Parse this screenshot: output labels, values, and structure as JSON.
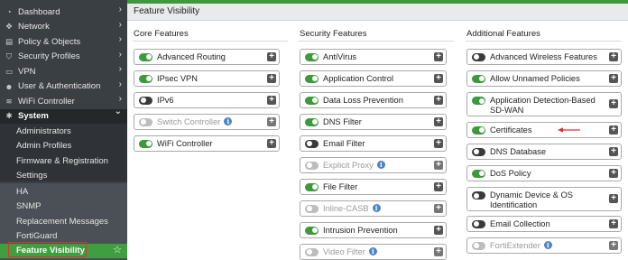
{
  "sidebar": {
    "items": [
      {
        "label": "Dashboard",
        "icon": "dashboard-icon",
        "glyph": "◔",
        "chevron": "›"
      },
      {
        "label": "Network",
        "icon": "network-icon",
        "glyph": "✥",
        "chevron": "›"
      },
      {
        "label": "Policy & Objects",
        "icon": "policy-icon",
        "glyph": "▤",
        "chevron": "›"
      },
      {
        "label": "Security Profiles",
        "icon": "shield-icon",
        "glyph": "⛉",
        "chevron": "›"
      },
      {
        "label": "VPN",
        "icon": "vpn-icon",
        "glyph": "▭",
        "chevron": "›"
      },
      {
        "label": "User & Authentication",
        "icon": "user-icon",
        "glyph": "☻",
        "chevron": "›"
      },
      {
        "label": "WiFi Controller",
        "icon": "wifi-icon",
        "glyph": "≋",
        "chevron": "›"
      }
    ],
    "system": {
      "label": "System",
      "icon": "gear-icon",
      "glyph": "✱",
      "chevron": "⌄"
    },
    "system_sub": [
      "Administrators",
      "Admin Profiles",
      "Firmware & Registration",
      "Settings"
    ],
    "system_sub2": [
      "HA",
      "SNMP",
      "Replacement Messages",
      "FortiGuard"
    ],
    "active": {
      "label": "Feature Visibility",
      "star": "☆"
    }
  },
  "header": {
    "title": "Feature Visibility"
  },
  "columns": {
    "core": {
      "title": "Core Features",
      "items": [
        {
          "label": "Advanced Routing",
          "state": "on"
        },
        {
          "label": "IPsec VPN",
          "state": "on"
        },
        {
          "label": "IPv6",
          "state": "off"
        },
        {
          "label": "Switch Controller",
          "state": "disabled",
          "info": true
        },
        {
          "label": "WiFi Controller",
          "state": "on"
        }
      ]
    },
    "security": {
      "title": "Security Features",
      "items": [
        {
          "label": "AntiVirus",
          "state": "on"
        },
        {
          "label": "Application Control",
          "state": "on"
        },
        {
          "label": "Data Loss Prevention",
          "state": "on"
        },
        {
          "label": "DNS Filter",
          "state": "on"
        },
        {
          "label": "Email Filter",
          "state": "off"
        },
        {
          "label": "Explicit Proxy",
          "state": "disabled",
          "info": true
        },
        {
          "label": "File Filter",
          "state": "on"
        },
        {
          "label": "Inline-CASB",
          "state": "disabled",
          "info": true
        },
        {
          "label": "Intrusion Prevention",
          "state": "on"
        },
        {
          "label": "Video Filter",
          "state": "disabled",
          "info": true
        }
      ]
    },
    "additional": {
      "title": "Additional Features",
      "items": [
        {
          "label": "Advanced Wireless Features",
          "state": "off"
        },
        {
          "label": "Allow Unnamed Policies",
          "state": "on"
        },
        {
          "label": "Application Detection-Based SD-WAN",
          "state": "on"
        },
        {
          "label": "Certificates",
          "state": "on"
        },
        {
          "label": "DNS Database",
          "state": "off"
        },
        {
          "label": "DoS Policy",
          "state": "on"
        },
        {
          "label": "Dynamic Device & OS Identification",
          "state": "off"
        },
        {
          "label": "Email Collection",
          "state": "off"
        },
        {
          "label": "FortiExtender",
          "state": "disabled",
          "info": true
        }
      ]
    }
  },
  "symbols": {
    "plus": "+",
    "info": "i"
  },
  "colors": {
    "accent": "#3c9a3c",
    "sidebar_bg": "#3a3f44",
    "highlight": "#e03030",
    "info": "#4d84c4"
  }
}
